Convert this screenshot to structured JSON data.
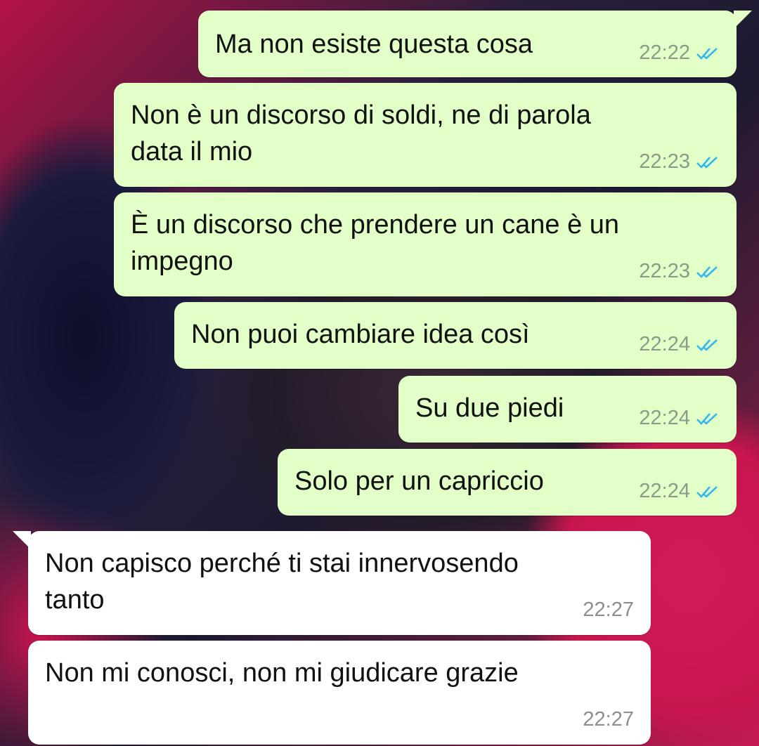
{
  "colors": {
    "outgoing_bubble": "#e1ffc7",
    "incoming_bubble": "#ffffff",
    "read_ticks": "#34b7f1",
    "time_text": "#8c9a8a"
  },
  "messages": [
    {
      "direction": "outgoing",
      "text": "Ma non esiste questa cosa",
      "time": "22:22",
      "status_icon": "double-check-read-icon"
    },
    {
      "direction": "outgoing",
      "text": "Non è un discorso di soldi, ne di parola\ndata il mio",
      "time": "22:23",
      "status_icon": "double-check-read-icon"
    },
    {
      "direction": "outgoing",
      "text": "È un discorso che prendere un cane è un\nimpegno",
      "time": "22:23",
      "status_icon": "double-check-read-icon"
    },
    {
      "direction": "outgoing",
      "text": "Non puoi cambiare idea così",
      "time": "22:24",
      "status_icon": "double-check-read-icon"
    },
    {
      "direction": "outgoing",
      "text": "Su due piedi",
      "time": "22:24",
      "status_icon": "double-check-read-icon"
    },
    {
      "direction": "outgoing",
      "text": "Solo per un capriccio",
      "time": "22:24",
      "status_icon": "double-check-read-icon"
    },
    {
      "direction": "incoming",
      "text": "Non capisco perché ti stai innervosendo\ntanto",
      "time": "22:27"
    },
    {
      "direction": "incoming",
      "text": "Non mi conosci, non mi giudicare grazie",
      "time": "22:27"
    }
  ]
}
